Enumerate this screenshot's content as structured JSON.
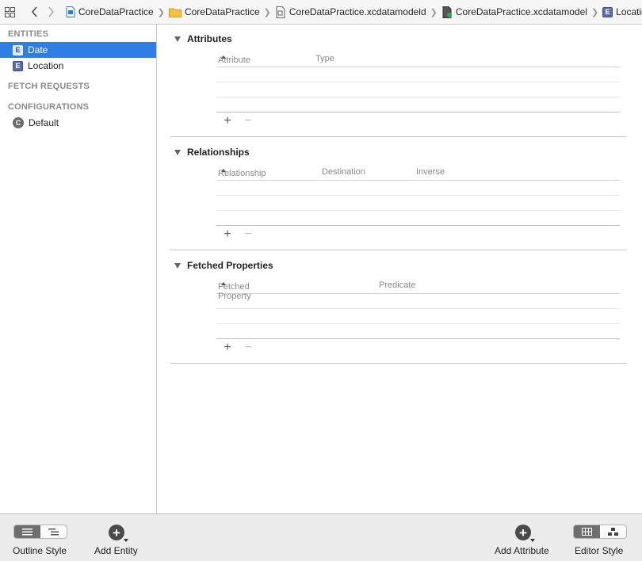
{
  "jumpbar": {
    "crumbs": [
      {
        "label": "CoreDataPractice",
        "icon": "project-file-icon"
      },
      {
        "label": "CoreDataPractice",
        "icon": "folder-icon"
      },
      {
        "label": "CoreDataPractice.xcdatamodeld",
        "icon": "versioned-model-icon"
      },
      {
        "label": "CoreDataPractice.xcdatamodel",
        "icon": "data-model-icon"
      },
      {
        "label": "Location",
        "icon": "entity-icon"
      }
    ]
  },
  "sidebar": {
    "entities_header": "ENTITIES",
    "entities": [
      {
        "label": "Date",
        "badge": "E",
        "selected": true
      },
      {
        "label": "Location",
        "badge": "E",
        "selected": false
      }
    ],
    "fetch_header": "FETCH REQUESTS",
    "config_header": "CONFIGURATIONS",
    "configurations": [
      {
        "label": "Default",
        "badge": "C"
      }
    ]
  },
  "attributes": {
    "title": "Attributes",
    "columns": [
      "Attribute",
      "Type"
    ],
    "plus": "+",
    "minus": "−"
  },
  "relationships": {
    "title": "Relationships",
    "columns": [
      "Relationship",
      "Destination",
      "Inverse"
    ],
    "plus": "+",
    "minus": "−"
  },
  "fetched": {
    "title": "Fetched Properties",
    "columns": [
      "Fetched Property",
      "Predicate"
    ],
    "plus": "+",
    "minus": "−"
  },
  "bottom": {
    "outline_label": "Outline Style",
    "add_entity_label": "Add Entity",
    "add_attribute_label": "Add Attribute",
    "editor_label": "Editor Style",
    "add_symbol": "+"
  },
  "colors": {
    "selection": "#2f7ee6",
    "entity_badge": "#5b6ea8"
  }
}
